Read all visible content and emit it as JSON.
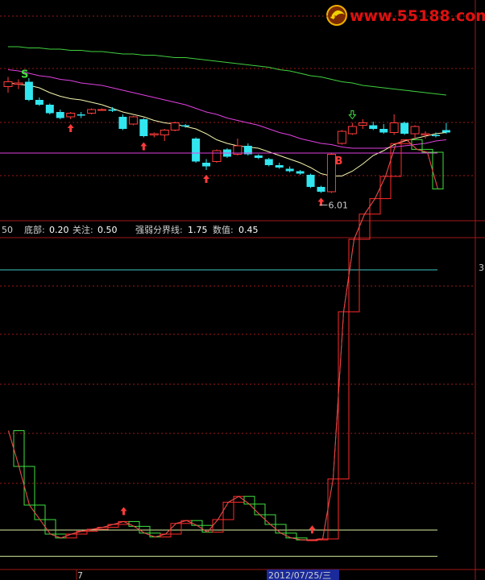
{
  "watermark": {
    "text": "www.55188.com"
  },
  "main_panel": {
    "low_label": "6.01",
    "marker_s": "S",
    "marker_b": "B"
  },
  "indicator_header": {
    "left_value": "50",
    "bottom_label": "底部:",
    "bottom_value": "0.20",
    "watch_label": "关注:",
    "watch_value": "0.50",
    "divide_label": "强弱分界线:",
    "divide_value": "1.75",
    "num_label": "数值:",
    "num_value": "0.45"
  },
  "right_edge_label": "3",
  "x_axis": {
    "month_label": "7",
    "date_label": "2012/07/25/三"
  },
  "colors": {
    "up": "#ff3b3b",
    "down": "#32e6f0",
    "ma_short": "#f5f5b0",
    "ma_mid": "#e040e0",
    "ma_long": "#40d040",
    "step_up": "#ff2a2a",
    "step_down": "#40e040",
    "grid": "#a01818"
  },
  "chart_data": [
    {
      "type": "candlestick",
      "title": "",
      "candles": [
        {
          "o": 0.85,
          "h": 0.93,
          "l": 0.8,
          "c": 0.89
        },
        {
          "o": 0.87,
          "h": 0.91,
          "l": 0.83,
          "c": 0.88
        },
        {
          "o": 0.89,
          "h": 0.92,
          "l": 0.73,
          "c": 0.74
        },
        {
          "o": 0.74,
          "h": 0.76,
          "l": 0.69,
          "c": 0.7
        },
        {
          "o": 0.7,
          "h": 0.71,
          "l": 0.62,
          "c": 0.63
        },
        {
          "o": 0.64,
          "h": 0.66,
          "l": 0.58,
          "c": 0.59
        },
        {
          "o": 0.6,
          "h": 0.64,
          "l": 0.58,
          "c": 0.63
        },
        {
          "o": 0.62,
          "h": 0.64,
          "l": 0.59,
          "c": 0.61
        },
        {
          "o": 0.63,
          "h": 0.67,
          "l": 0.62,
          "c": 0.66
        },
        {
          "o": 0.66,
          "h": 0.67,
          "l": 0.65,
          "c": 0.66
        },
        {
          "o": 0.66,
          "h": 0.68,
          "l": 0.64,
          "c": 0.65
        },
        {
          "o": 0.6,
          "h": 0.62,
          "l": 0.49,
          "c": 0.5
        },
        {
          "o": 0.54,
          "h": 0.61,
          "l": 0.53,
          "c": 0.6
        },
        {
          "o": 0.58,
          "h": 0.59,
          "l": 0.43,
          "c": 0.44
        },
        {
          "o": 0.45,
          "h": 0.47,
          "l": 0.43,
          "c": 0.46
        },
        {
          "o": 0.45,
          "h": 0.5,
          "l": 0.4,
          "c": 0.49
        },
        {
          "o": 0.49,
          "h": 0.56,
          "l": 0.48,
          "c": 0.55
        },
        {
          "o": 0.53,
          "h": 0.54,
          "l": 0.51,
          "c": 0.52
        },
        {
          "o": 0.42,
          "h": 0.43,
          "l": 0.22,
          "c": 0.23
        },
        {
          "o": 0.22,
          "h": 0.25,
          "l": 0.16,
          "c": 0.19
        },
        {
          "o": 0.23,
          "h": 0.33,
          "l": 0.22,
          "c": 0.32
        },
        {
          "o": 0.33,
          "h": 0.34,
          "l": 0.26,
          "c": 0.27
        },
        {
          "o": 0.29,
          "h": 0.42,
          "l": 0.28,
          "c": 0.36
        },
        {
          "o": 0.36,
          "h": 0.38,
          "l": 0.28,
          "c": 0.29
        },
        {
          "o": 0.28,
          "h": 0.29,
          "l": 0.25,
          "c": 0.26
        },
        {
          "o": 0.25,
          "h": 0.26,
          "l": 0.19,
          "c": 0.2
        },
        {
          "o": 0.2,
          "h": 0.22,
          "l": 0.17,
          "c": 0.18
        },
        {
          "o": 0.17,
          "h": 0.19,
          "l": 0.14,
          "c": 0.15
        },
        {
          "o": 0.15,
          "h": 0.16,
          "l": 0.12,
          "c": 0.13
        },
        {
          "o": 0.12,
          "h": 0.13,
          "l": 0.01,
          "c": 0.02
        },
        {
          "o": 0.02,
          "h": 0.03,
          "l": -0.03,
          "c": -0.02
        },
        {
          "o": -0.02,
          "h": 0.3,
          "l": -0.03,
          "c": 0.29
        },
        {
          "o": 0.38,
          "h": 0.49,
          "l": 0.37,
          "c": 0.48
        },
        {
          "o": 0.46,
          "h": 0.55,
          "l": 0.45,
          "c": 0.52
        },
        {
          "o": 0.53,
          "h": 0.58,
          "l": 0.5,
          "c": 0.55
        },
        {
          "o": 0.53,
          "h": 0.56,
          "l": 0.49,
          "c": 0.5
        },
        {
          "o": 0.5,
          "h": 0.54,
          "l": 0.46,
          "c": 0.47
        },
        {
          "o": 0.47,
          "h": 0.62,
          "l": 0.45,
          "c": 0.55
        },
        {
          "o": 0.55,
          "h": 0.56,
          "l": 0.45,
          "c": 0.46
        },
        {
          "o": 0.46,
          "h": 0.53,
          "l": 0.42,
          "c": 0.52
        },
        {
          "o": 0.45,
          "h": 0.48,
          "l": 0.42,
          "c": 0.46
        },
        {
          "o": 0.45,
          "h": 0.47,
          "l": 0.43,
          "c": 0.44
        },
        {
          "o": 0.49,
          "h": 0.55,
          "l": 0.46,
          "c": 0.47
        }
      ],
      "ma_short": [
        0.88,
        0.87,
        0.86,
        0.84,
        0.8,
        0.77,
        0.75,
        0.74,
        0.72,
        0.7,
        0.67,
        0.64,
        0.62,
        0.6,
        0.57,
        0.55,
        0.54,
        0.52,
        0.5,
        0.46,
        0.41,
        0.38,
        0.36,
        0.35,
        0.34,
        0.31,
        0.28,
        0.25,
        0.22,
        0.18,
        0.13,
        0.11,
        0.11,
        0.15,
        0.21,
        0.28,
        0.32,
        0.37,
        0.4,
        0.42,
        0.44,
        0.46,
        0.47
      ],
      "ma_mid": [
        0.99,
        0.98,
        0.96,
        0.94,
        0.93,
        0.91,
        0.9,
        0.88,
        0.87,
        0.86,
        0.84,
        0.82,
        0.8,
        0.78,
        0.76,
        0.74,
        0.72,
        0.7,
        0.67,
        0.64,
        0.62,
        0.59,
        0.57,
        0.55,
        0.53,
        0.5,
        0.47,
        0.45,
        0.42,
        0.4,
        0.38,
        0.37,
        0.35,
        0.34,
        0.34,
        0.34,
        0.34,
        0.35,
        0.36,
        0.37,
        0.38,
        0.4,
        0.41
      ],
      "ma_long": [
        1.18,
        1.18,
        1.17,
        1.17,
        1.16,
        1.16,
        1.15,
        1.15,
        1.14,
        1.14,
        1.13,
        1.12,
        1.12,
        1.11,
        1.11,
        1.1,
        1.09,
        1.09,
        1.08,
        1.07,
        1.06,
        1.05,
        1.04,
        1.03,
        1.02,
        1.01,
        0.99,
        0.98,
        0.96,
        0.94,
        0.93,
        0.91,
        0.89,
        0.88,
        0.86,
        0.85,
        0.84,
        0.83,
        0.82,
        0.81,
        0.8,
        0.79,
        0.78
      ],
      "buy_arrows": [
        6,
        13,
        19,
        30
      ],
      "sell_arrows": [
        33
      ]
    },
    {
      "type": "step",
      "series": [
        {
          "values": [
            1.32,
            0.95,
            0.55,
            0.4,
            0.25,
            0.21,
            0.25,
            0.28,
            0.3,
            0.32,
            0.35,
            0.38,
            0.33,
            0.26,
            0.22,
            0.25,
            0.36,
            0.39,
            0.34,
            0.27,
            0.4,
            0.58,
            0.64,
            0.56,
            0.45,
            0.35,
            0.26,
            0.21,
            0.19,
            0.19,
            0.2,
            0.82,
            2.55,
            3.3,
            3.56,
            3.72,
            3.95,
            4.29,
            4.33,
            4.23,
            4.2,
            3.82
          ]
        }
      ],
      "reference_lines": [
        0.2,
        0.5,
        1.75
      ]
    }
  ]
}
